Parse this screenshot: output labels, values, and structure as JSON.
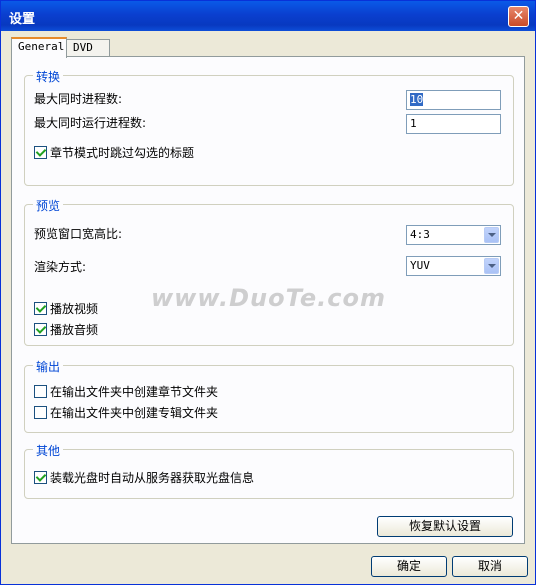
{
  "window": {
    "title": "设置",
    "close_symbol": "✕"
  },
  "tabs": [
    {
      "label": "General"
    },
    {
      "label": "DVD"
    }
  ],
  "groups": {
    "convert": {
      "title": "转换",
      "max_processes_label": "最大同时进程数:",
      "max_processes_value": "10",
      "max_running_label": "最大同时运行进程数:",
      "max_running_value": "1",
      "skip_titles_label": "章节模式时跳过勾选的标题"
    },
    "preview": {
      "title": "预览",
      "aspect_label": "预览窗口宽高比:",
      "aspect_value": "4:3",
      "render_label": "渲染方式:",
      "render_value": "YUV",
      "play_video_label": "播放视频",
      "play_audio_label": "播放音频"
    },
    "output": {
      "title": "输出",
      "chapter_folder_label": "在输出文件夹中创建章节文件夹",
      "album_folder_label": "在输出文件夹中创建专辑文件夹"
    },
    "other": {
      "title": "其他",
      "autofetch_label": "装载光盘时自动从服务器获取光盘信息"
    }
  },
  "buttons": {
    "restore": "恢复默认设置",
    "ok": "确定",
    "cancel": "取消"
  },
  "watermark": "www.DuoTe.com",
  "colors": {
    "titlebar": "#0a3fcf",
    "group_title": "#0046d5",
    "close": "#c94a28"
  }
}
